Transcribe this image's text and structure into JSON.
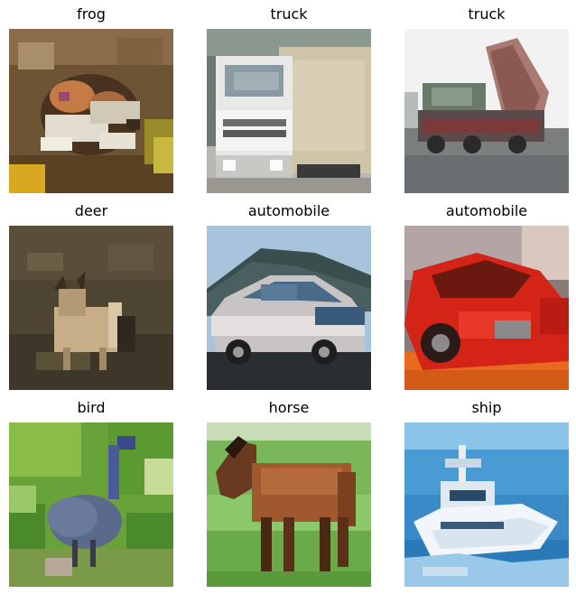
{
  "panels": [
    {
      "label": "frog"
    },
    {
      "label": "truck"
    },
    {
      "label": "truck"
    },
    {
      "label": "deer"
    },
    {
      "label": "automobile"
    },
    {
      "label": "automobile"
    },
    {
      "label": "bird"
    },
    {
      "label": "horse"
    },
    {
      "label": "ship"
    }
  ]
}
